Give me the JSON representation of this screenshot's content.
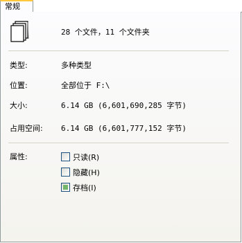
{
  "tab": {
    "label": "常规"
  },
  "summary": {
    "text": "28 个文件，11 个文件夹"
  },
  "properties": {
    "type": {
      "label": "类型:",
      "value": "多种类型"
    },
    "location": {
      "label": "位置:",
      "value": "全部位于 F:\\"
    },
    "size": {
      "label": "大小:",
      "value": "6.14 GB (6,601,690,285 字节)"
    },
    "size_on_disk": {
      "label": "占用空间:",
      "value": "6.14 GB (6,601,777,152 字节)"
    }
  },
  "attributes": {
    "label": "属性:",
    "readonly": {
      "label": "只读(R)",
      "checked": false
    },
    "hidden": {
      "label": "隐藏(H)",
      "checked": false
    },
    "archive": {
      "label": "存档(I)",
      "checked": "mixed"
    }
  },
  "colors": {
    "tab_accent": "#ffc83c",
    "border": "#919b9c",
    "checkbox_border": "#1c5180",
    "indeterminate_fill": "#73b56b"
  },
  "icons": {
    "files": "multiple-files-icon"
  }
}
